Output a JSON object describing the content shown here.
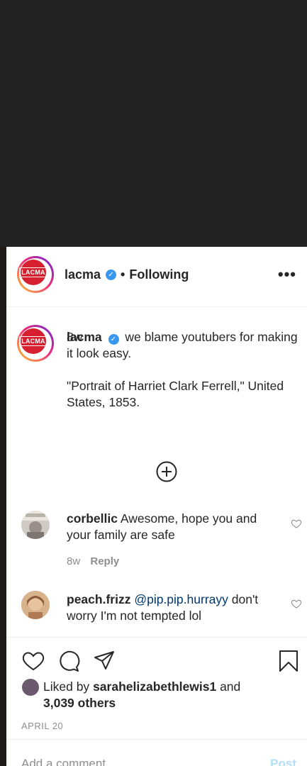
{
  "post": {
    "account": "lacma",
    "logo_text": "LACMA",
    "follow_status": "Following",
    "separator": "•",
    "more_label": "•••"
  },
  "caption": {
    "user": "lacma",
    "text_line1": "we blame youtubers for making it look easy.",
    "text_line2": "\"Portrait of Harriet Clark Ferrell,\" United States, 1853.",
    "age": "8w"
  },
  "comments": [
    {
      "user": "corbellic",
      "text": "Awesome, hope you and your family are safe",
      "age": "8w",
      "reply_label": "Reply"
    },
    {
      "user": "peach.frizz",
      "mention": "@pip.pip.hurrayy",
      "text": "don't worry I'm not tempted lol"
    }
  ],
  "likes": {
    "prefix": "Liked by",
    "user": "sarahelizabethlewis1",
    "middle": "and",
    "others": "3,039 others"
  },
  "date": "APRIL 20",
  "add_comment": {
    "placeholder": "Add a comment...",
    "post_label": "Post"
  },
  "colors": {
    "verified": "#3897f0",
    "mention": "#00376b",
    "post_disabled": "#b2dffc",
    "brand_logo": "#d6202f"
  }
}
